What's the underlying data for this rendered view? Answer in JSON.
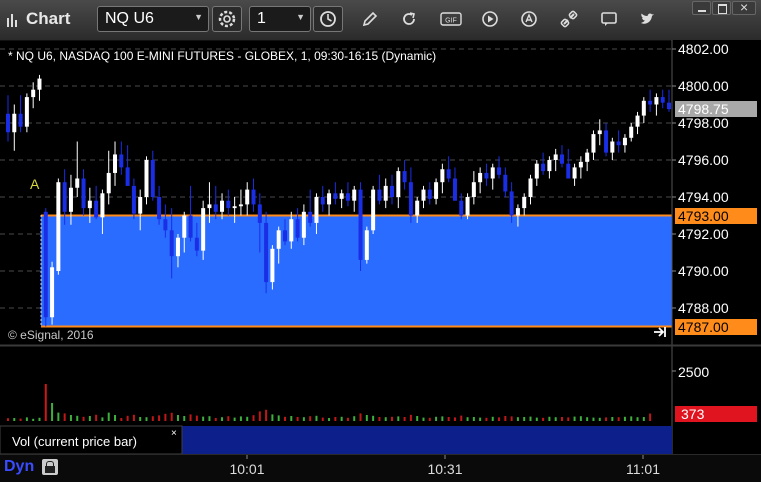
{
  "window": {
    "title": "Chart"
  },
  "toolbar": {
    "symbol": "NQ U6",
    "interval": "1",
    "gif_label": "GIF"
  },
  "chart": {
    "header": "* NQ U6, NASDAQ 100 E-MINI FUTURES - GLOBEX, 1, 09:30-16:15 (Dynamic)",
    "copyright": "© eSignal, 2016",
    "marker_label": "A",
    "price_labels": [
      "4802.00",
      "4800.00",
      "4798.00",
      "4796.00",
      "4794.00",
      "4792.00",
      "4790.00",
      "4788.00"
    ],
    "last_price": "4798.75",
    "level_high": "4793.00",
    "level_low": "4787.00",
    "volume_tick": "2500",
    "volume_value": "373",
    "time_labels": [
      "10:01",
      "10:31",
      "11:01"
    ],
    "study_label": "Vol (current price bar)",
    "study_close": "×",
    "workspace_label": "Dyn",
    "colors": {
      "up": "#ffffff",
      "down": "#1a2ee6",
      "band": "#2a6cff",
      "level": "#ff8c1a",
      "last_price_bg": "#a8a8a8",
      "volume_badge": "#e0141e"
    }
  },
  "chart_data": {
    "type": "candlestick",
    "symbol": "NQ U6",
    "ylim": [
      4787,
      4803
    ],
    "levels": [
      4793.0,
      4787.0
    ],
    "last": 4798.75,
    "x_ticks": [
      "10:01",
      "10:31",
      "11:01"
    ],
    "candles": [
      [
        4798.5,
        4799.5,
        4797.0,
        4797.5
      ],
      [
        4797.5,
        4799.0,
        4796.5,
        4798.5
      ],
      [
        4798.5,
        4799.5,
        4797.5,
        4797.8
      ],
      [
        4797.8,
        4799.6,
        4797.5,
        4799.4
      ],
      [
        4799.4,
        4800.2,
        4798.8,
        4799.8
      ],
      [
        4799.8,
        4800.6,
        4799.2,
        4800.4
      ],
      [
        4793.2,
        4793.4,
        4787.0,
        4787.5
      ],
      [
        4787.5,
        4790.5,
        4787.1,
        4790.2
      ],
      [
        4790.0,
        4795.0,
        4789.8,
        4794.8
      ],
      [
        4794.8,
        4795.5,
        4792.5,
        4793.2
      ],
      [
        4793.2,
        4795.2,
        4792.5,
        4794.5
      ],
      [
        4794.5,
        4797.0,
        4794.0,
        4795.0
      ],
      [
        4795.0,
        4795.5,
        4793.0,
        4793.4
      ],
      [
        4793.4,
        4794.5,
        4792.6,
        4793.8
      ],
      [
        4793.8,
        4794.6,
        4792.8,
        4792.9
      ],
      [
        4792.9,
        4794.4,
        4792.0,
        4794.2
      ],
      [
        4794.2,
        4796.5,
        4793.6,
        4795.3
      ],
      [
        4795.3,
        4797.0,
        4794.6,
        4796.3
      ],
      [
        4796.3,
        4797.0,
        4795.2,
        4795.6
      ],
      [
        4795.6,
        4796.8,
        4794.8,
        4794.6
      ],
      [
        4794.6,
        4795.0,
        4792.8,
        4793.1
      ],
      [
        4793.1,
        4794.4,
        4792.2,
        4794.0
      ],
      [
        4794.0,
        4796.2,
        4793.6,
        4796.0
      ],
      [
        4796.0,
        4796.5,
        4793.8,
        4794.0
      ],
      [
        4794.0,
        4794.6,
        4792.5,
        4792.8
      ],
      [
        4792.8,
        4793.6,
        4791.8,
        4792.2
      ],
      [
        4792.2,
        4793.4,
        4789.6,
        4790.8
      ],
      [
        4790.8,
        4792.0,
        4790.2,
        4791.8
      ],
      [
        4791.8,
        4793.2,
        4791.0,
        4793.0
      ],
      [
        4793.0,
        4794.6,
        4791.6,
        4791.8
      ],
      [
        4791.8,
        4792.6,
        4790.8,
        4791.1
      ],
      [
        4791.1,
        4793.8,
        4790.6,
        4793.4
      ],
      [
        4793.4,
        4794.8,
        4792.6,
        4793.6
      ],
      [
        4793.6,
        4794.6,
        4792.8,
        4793.2
      ],
      [
        4793.2,
        4794.2,
        4792.8,
        4793.8
      ],
      [
        4793.8,
        4794.4,
        4793.0,
        4793.4
      ],
      [
        4793.4,
        4794.0,
        4792.6,
        4793.5
      ],
      [
        4793.5,
        4794.4,
        4793.0,
        4793.6
      ],
      [
        4793.6,
        4794.8,
        4793.0,
        4794.4
      ],
      [
        4794.4,
        4795.0,
        4793.2,
        4793.6
      ],
      [
        4793.6,
        4794.2,
        4791.0,
        4792.6
      ],
      [
        4792.6,
        4793.2,
        4788.8,
        4789.4
      ],
      [
        4789.4,
        4791.4,
        4789.0,
        4791.2
      ],
      [
        4791.2,
        4792.4,
        4790.4,
        4792.2
      ],
      [
        4792.2,
        4792.8,
        4791.4,
        4791.6
      ],
      [
        4791.6,
        4793.2,
        4791.2,
        4792.8
      ],
      [
        4792.8,
        4793.4,
        4791.6,
        4791.8
      ],
      [
        4791.8,
        4793.6,
        4791.4,
        4793.2
      ],
      [
        4793.2,
        4794.4,
        4792.4,
        4792.6
      ],
      [
        4792.6,
        4794.2,
        4792.0,
        4794.0
      ],
      [
        4794.0,
        4794.6,
        4793.2,
        4793.6
      ],
      [
        4793.6,
        4794.4,
        4793.0,
        4794.2
      ],
      [
        4794.2,
        4794.8,
        4793.6,
        4793.9
      ],
      [
        4793.9,
        4794.4,
        4793.4,
        4794.2
      ],
      [
        4794.2,
        4794.8,
        4793.5,
        4793.8
      ],
      [
        4793.8,
        4794.6,
        4793.2,
        4794.4
      ],
      [
        4794.4,
        4794.8,
        4790.0,
        4790.6
      ],
      [
        4790.6,
        4792.4,
        4790.4,
        4792.2
      ],
      [
        4792.2,
        4794.6,
        4792.0,
        4794.4
      ],
      [
        4794.4,
        4795.2,
        4793.6,
        4793.8
      ],
      [
        4793.8,
        4795.0,
        4793.4,
        4794.6
      ],
      [
        4794.6,
        4795.2,
        4793.6,
        4794.0
      ],
      [
        4794.0,
        4795.6,
        4793.4,
        4795.4
      ],
      [
        4795.4,
        4796.0,
        4794.4,
        4794.8
      ],
      [
        4794.8,
        4795.6,
        4792.6,
        4793.0
      ],
      [
        4793.0,
        4794.0,
        4792.6,
        4793.8
      ],
      [
        4793.8,
        4794.6,
        4793.4,
        4794.4
      ],
      [
        4794.4,
        4794.8,
        4793.6,
        4793.9
      ],
      [
        4793.9,
        4795.0,
        4793.6,
        4794.8
      ],
      [
        4794.8,
        4795.8,
        4794.2,
        4795.5
      ],
      [
        4795.5,
        4796.2,
        4794.8,
        4795.0
      ],
      [
        4795.0,
        4795.6,
        4793.8,
        4793.8
      ],
      [
        4793.8,
        4794.2,
        4792.8,
        4793.0
      ],
      [
        4793.0,
        4794.2,
        4792.8,
        4794.0
      ],
      [
        4794.0,
        4795.4,
        4793.6,
        4794.8
      ],
      [
        4794.8,
        4795.6,
        4794.2,
        4795.3
      ],
      [
        4795.3,
        4795.8,
        4794.6,
        4795.0
      ],
      [
        4795.0,
        4795.8,
        4794.4,
        4795.6
      ],
      [
        4795.6,
        4796.2,
        4795.0,
        4795.2
      ],
      [
        4795.2,
        4795.6,
        4794.0,
        4794.3
      ],
      [
        4794.3,
        4794.8,
        4792.6,
        4793.0
      ],
      [
        4793.0,
        4793.6,
        4792.4,
        4793.4
      ],
      [
        4793.4,
        4794.2,
        4793.0,
        4794.0
      ],
      [
        4794.0,
        4795.2,
        4793.6,
        4795.0
      ],
      [
        4795.0,
        4796.0,
        4794.6,
        4795.8
      ],
      [
        4795.8,
        4796.4,
        4795.2,
        4795.4
      ],
      [
        4795.4,
        4796.2,
        4795.0,
        4796.0
      ],
      [
        4796.0,
        4796.6,
        4795.4,
        4796.3
      ],
      [
        4796.3,
        4796.8,
        4795.6,
        4795.8
      ],
      [
        4795.8,
        4796.6,
        4795.0,
        4795.0
      ],
      [
        4795.0,
        4795.8,
        4794.6,
        4795.6
      ],
      [
        4795.6,
        4796.2,
        4795.0,
        4795.9
      ],
      [
        4795.9,
        4796.6,
        4795.4,
        4796.4
      ],
      [
        4796.4,
        4797.6,
        4796.0,
        4797.4
      ],
      [
        4797.4,
        4798.2,
        4796.8,
        4797.6
      ],
      [
        4797.6,
        4798.0,
        4796.2,
        4796.4
      ],
      [
        4796.4,
        4797.2,
        4796.0,
        4797.0
      ],
      [
        4797.0,
        4797.6,
        4796.4,
        4796.8
      ],
      [
        4796.8,
        4797.4,
        4796.4,
        4797.2
      ],
      [
        4797.2,
        4798.0,
        4797.0,
        4797.8
      ],
      [
        4797.8,
        4798.6,
        4797.4,
        4798.4
      ],
      [
        4798.4,
        4799.4,
        4798.0,
        4799.2
      ],
      [
        4799.2,
        4799.8,
        4798.6,
        4799.0
      ],
      [
        4799.0,
        4799.6,
        4798.4,
        4799.4
      ],
      [
        4799.4,
        4799.8,
        4798.8,
        4799.1
      ],
      [
        4799.1,
        4799.8,
        4798.6,
        4798.75
      ]
    ],
    "volume": [
      140,
      150,
      120,
      180,
      110,
      160,
      1850,
      900,
      420,
      380,
      300,
      260,
      210,
      250,
      310,
      180,
      420,
      300,
      150,
      260,
      310,
      200,
      190,
      240,
      280,
      360,
      410,
      300,
      250,
      330,
      270,
      220,
      240,
      150,
      190,
      240,
      170,
      230,
      210,
      290,
      480,
      560,
      330,
      280,
      210,
      250,
      200,
      190,
      240,
      260,
      170,
      150,
      200,
      210,
      160,
      240,
      380,
      300,
      260,
      200,
      190,
      210,
      230,
      200,
      310,
      250,
      170,
      160,
      210,
      230,
      200,
      180,
      270,
      190,
      200,
      170,
      160,
      210,
      180,
      250,
      230,
      190,
      200,
      220,
      170,
      160,
      210,
      190,
      200,
      180,
      220,
      240,
      190,
      170,
      160,
      180,
      200,
      190,
      210,
      230,
      190,
      200,
      373
    ]
  }
}
